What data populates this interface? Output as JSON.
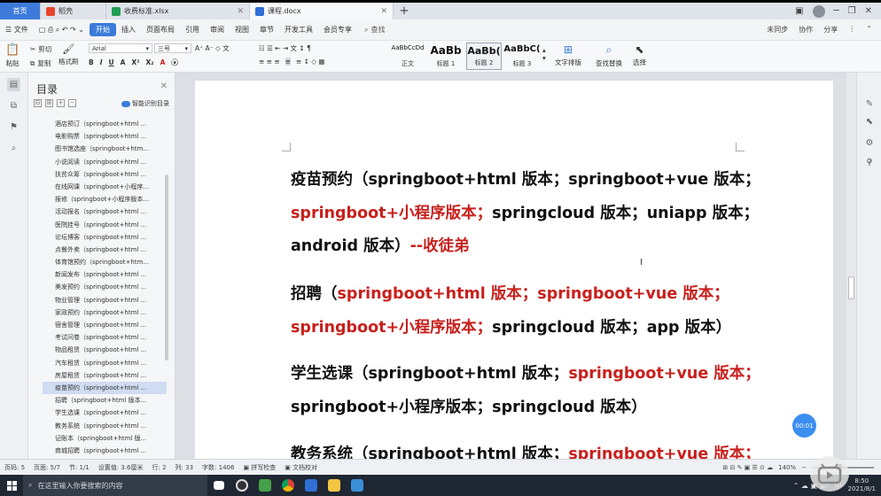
{
  "tabs": {
    "home": "首页",
    "t1": "稻壳",
    "t2": "收费标准.xlsx",
    "t3": "课程.docx"
  },
  "menubar": {
    "file": "文件",
    "items": [
      "开始",
      "插入",
      "页面布局",
      "引用",
      "审阅",
      "视图",
      "章节",
      "开发工具",
      "会员专享"
    ],
    "search": "查找",
    "right": [
      "未同步",
      "协作",
      "分享"
    ]
  },
  "ribbon": {
    "paste": "粘贴",
    "cut": "剪切",
    "copy": "复制",
    "format_painter": "格式刷",
    "font": "Arial",
    "size": "三号",
    "styles": [
      {
        "preview": "AaBbCcDd",
        "label": "正文"
      },
      {
        "preview": "AaBb",
        "label": "标题 1"
      },
      {
        "preview": "AaBb(",
        "label": "标题 2"
      },
      {
        "preview": "AaBbC(",
        "label": "标题 3"
      }
    ],
    "layout": "文字排版",
    "find_replace": "查找替换",
    "select": "选择"
  },
  "toc": {
    "title": "目录",
    "smart": "智能识别目录",
    "items": [
      "酒店预订（springboot+html ...",
      "电影购票（springboot+html ...",
      "图书馆选座（springboot+htm...",
      "小说阅读（springboot+html ...",
      "扶贫众筹（springboot+html ...",
      "在线网课（springboot+小程序...",
      "报修（springboot+小程序版本...",
      "活动报名（springboot+html ...",
      "医院挂号（springboot+html ...",
      "论坛博客（springboot+html ...",
      "点餐外卖（springboot+html ...",
      "体育馆预约（springboot+htm...",
      "新闻发布（springboot+html ...",
      "美发预约（springboot+html ...",
      "物业管理（springboot+html ...",
      "家政预约（springboot+html ...",
      "宿舍管理（springboot+html ...",
      "考试问卷（springboot+html ...",
      "物品租赁（springboot+html ...",
      "汽车租赁（springboot+html ...",
      "房屋租赁（springboot+html ...",
      "疫苗预约（springboot+html ...",
      "招聘（springboot+html 版本...",
      "学生选课（springboot+html ...",
      "教务系统（springboot+html ...",
      "记账本（springboot+html 版...",
      "商城招聘（springboot+html ..."
    ],
    "active_index": 21
  },
  "doc": {
    "lines": [
      [
        {
          "t": "疫苗预约（springboot+html 版本；springboot+vue 版本；",
          "red": false
        }
      ],
      [
        {
          "t": "springboot+小程序版本；",
          "red": true
        },
        {
          "t": "springcloud 版本；uniapp 版本；",
          "red": false
        }
      ],
      [
        {
          "t": "android 版本）",
          "red": false
        },
        {
          "t": "--收徒弟",
          "red": true
        }
      ],
      [
        {
          "t": "招聘（",
          "red": false
        },
        {
          "t": "springboot+html 版本；springboot+vue 版本；",
          "red": true
        }
      ],
      [
        {
          "t": "springboot+小程序版本；",
          "red": true
        },
        {
          "t": "springcloud 版本；app 版本）",
          "red": false
        }
      ],
      [
        {
          "t": "学生选课（springboot+html 版本；",
          "red": false
        },
        {
          "t": "springboot+vue 版本；",
          "red": true
        }
      ],
      [
        {
          "t": "springboot+小程序版本；springcloud 版本）",
          "red": false
        }
      ],
      [
        {
          "t": "教务系统（springboot+html 版本；",
          "red": false
        },
        {
          "t": "springboot+vue 版本；",
          "red": true
        }
      ]
    ]
  },
  "timer": "00:01",
  "status": {
    "page": "页码: 5",
    "pages": "页面: 5/7",
    "section": "节: 1/1",
    "setting": "设置值: 3.6厘米",
    "row": "行: 2",
    "col": "列: 33",
    "words": "字数: 1406",
    "spell": "拼写检查",
    "proof": "文档校对",
    "zoom": "140%"
  },
  "taskbar": {
    "search": "在这里输入你要搜索的内容",
    "time": "8:50",
    "date": "2021/8/1",
    "ime": "中"
  }
}
